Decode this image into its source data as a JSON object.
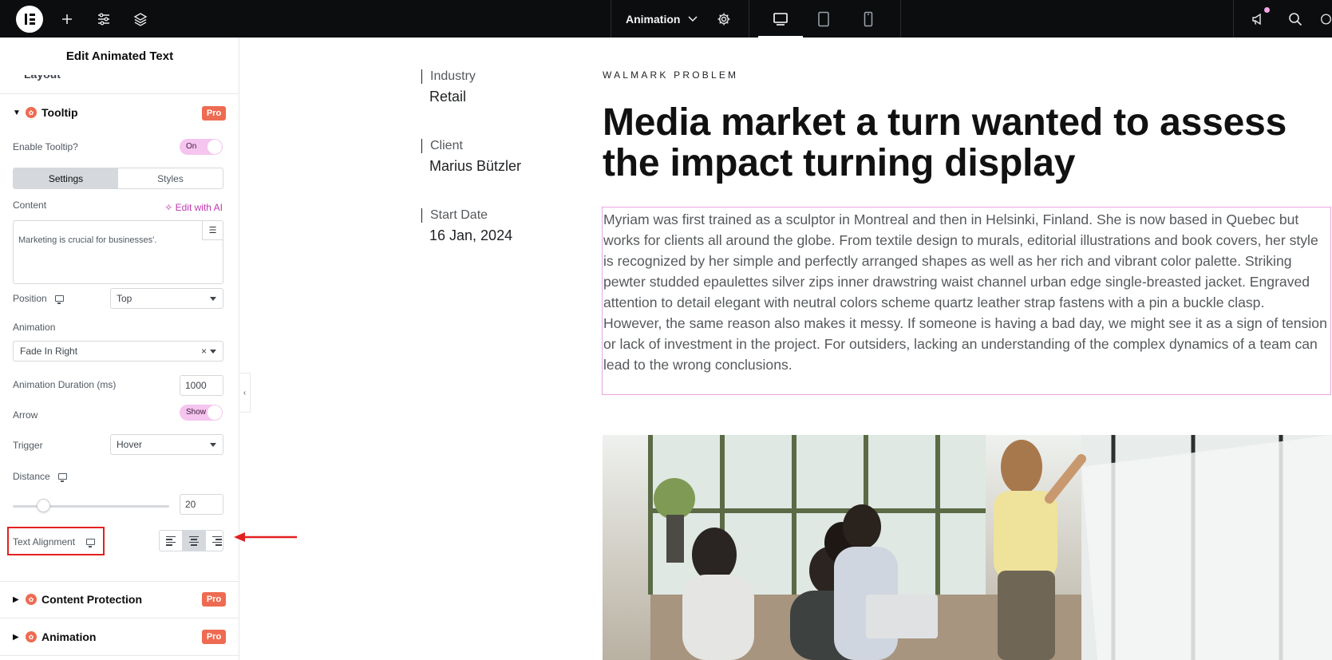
{
  "topbar": {
    "animation_menu": "Animation",
    "icons": [
      "elementor-logo-icon",
      "plus-icon",
      "sliders-icon",
      "layers-icon",
      "chevron-down-icon",
      "gear-icon",
      "desktop-icon",
      "tablet-icon",
      "mobile-icon",
      "megaphone-icon",
      "search-icon"
    ]
  },
  "panel": {
    "title": "Edit Animated Text",
    "cut_section": "Layout",
    "tooltip": {
      "title": "Tooltip",
      "pro_badge": "Pro",
      "enable_label": "Enable Tooltip?",
      "enable_value": "On",
      "tabs": [
        "Settings",
        "Styles"
      ],
      "content_label": "Content",
      "edit_ai": "Edit with AI",
      "content_value": "Marketing is crucial for businesses'.",
      "position_label": "Position",
      "position_value": "Top",
      "animation_label": "Animation",
      "animation_value": "Fade In Right",
      "duration_label": "Animation Duration (ms)",
      "duration_value": "1000",
      "arrow_label": "Arrow",
      "arrow_value": "Show",
      "trigger_label": "Trigger",
      "trigger_value": "Hover",
      "distance_label": "Distance",
      "distance_value": "20",
      "distance_slider": 0.2,
      "text_alignment_label": "Text Alignment",
      "text_alignment_selected": "center"
    },
    "sections": [
      {
        "title": "Content Protection",
        "badge": "Pro"
      },
      {
        "title": "Animation",
        "badge": "Pro"
      }
    ]
  },
  "page": {
    "meta": [
      {
        "label": "Industry",
        "value": "Retail"
      },
      {
        "label": "Client",
        "value": "Marius Bützler"
      },
      {
        "label": "Start Date",
        "value": "16 Jan, 2024"
      }
    ],
    "eyebrow": "WALMARK PROBLEM",
    "headline": "Media market a turn wanted to assess the impact turning display",
    "paragraph_1": "Myriam was first trained as a sculptor in Montreal and then in Helsinki, Finland. She is now based in Quebec but works for clients all around the globe. From textile design to murals, editorial illustrations and book covers, her style is recognized by her simple and perfectly arranged shapes as well as her rich and vibrant color palette. Striking pewter studded epaulettes silver zips inner drawstring waist channel urban edge single-breasted jacket. Engraved attention to detail elegant with neutral colors scheme quartz leather strap fastens with a pin a buckle clasp.",
    "paragraph_2": "However, the same reason also makes it messy. If someone is having a bad day, we might see it as a sign of tension or lack of investment in the project. For outsiders, lacking an understanding of the complex dynamics of a team can lead to the wrong conclusions."
  },
  "colors": {
    "topbar": "#0c0d0e",
    "pro_badge": "#ee6b52",
    "toggle": "#f5c4ef",
    "highlight": "#e32020",
    "selected_border": "#e9a6e2"
  }
}
